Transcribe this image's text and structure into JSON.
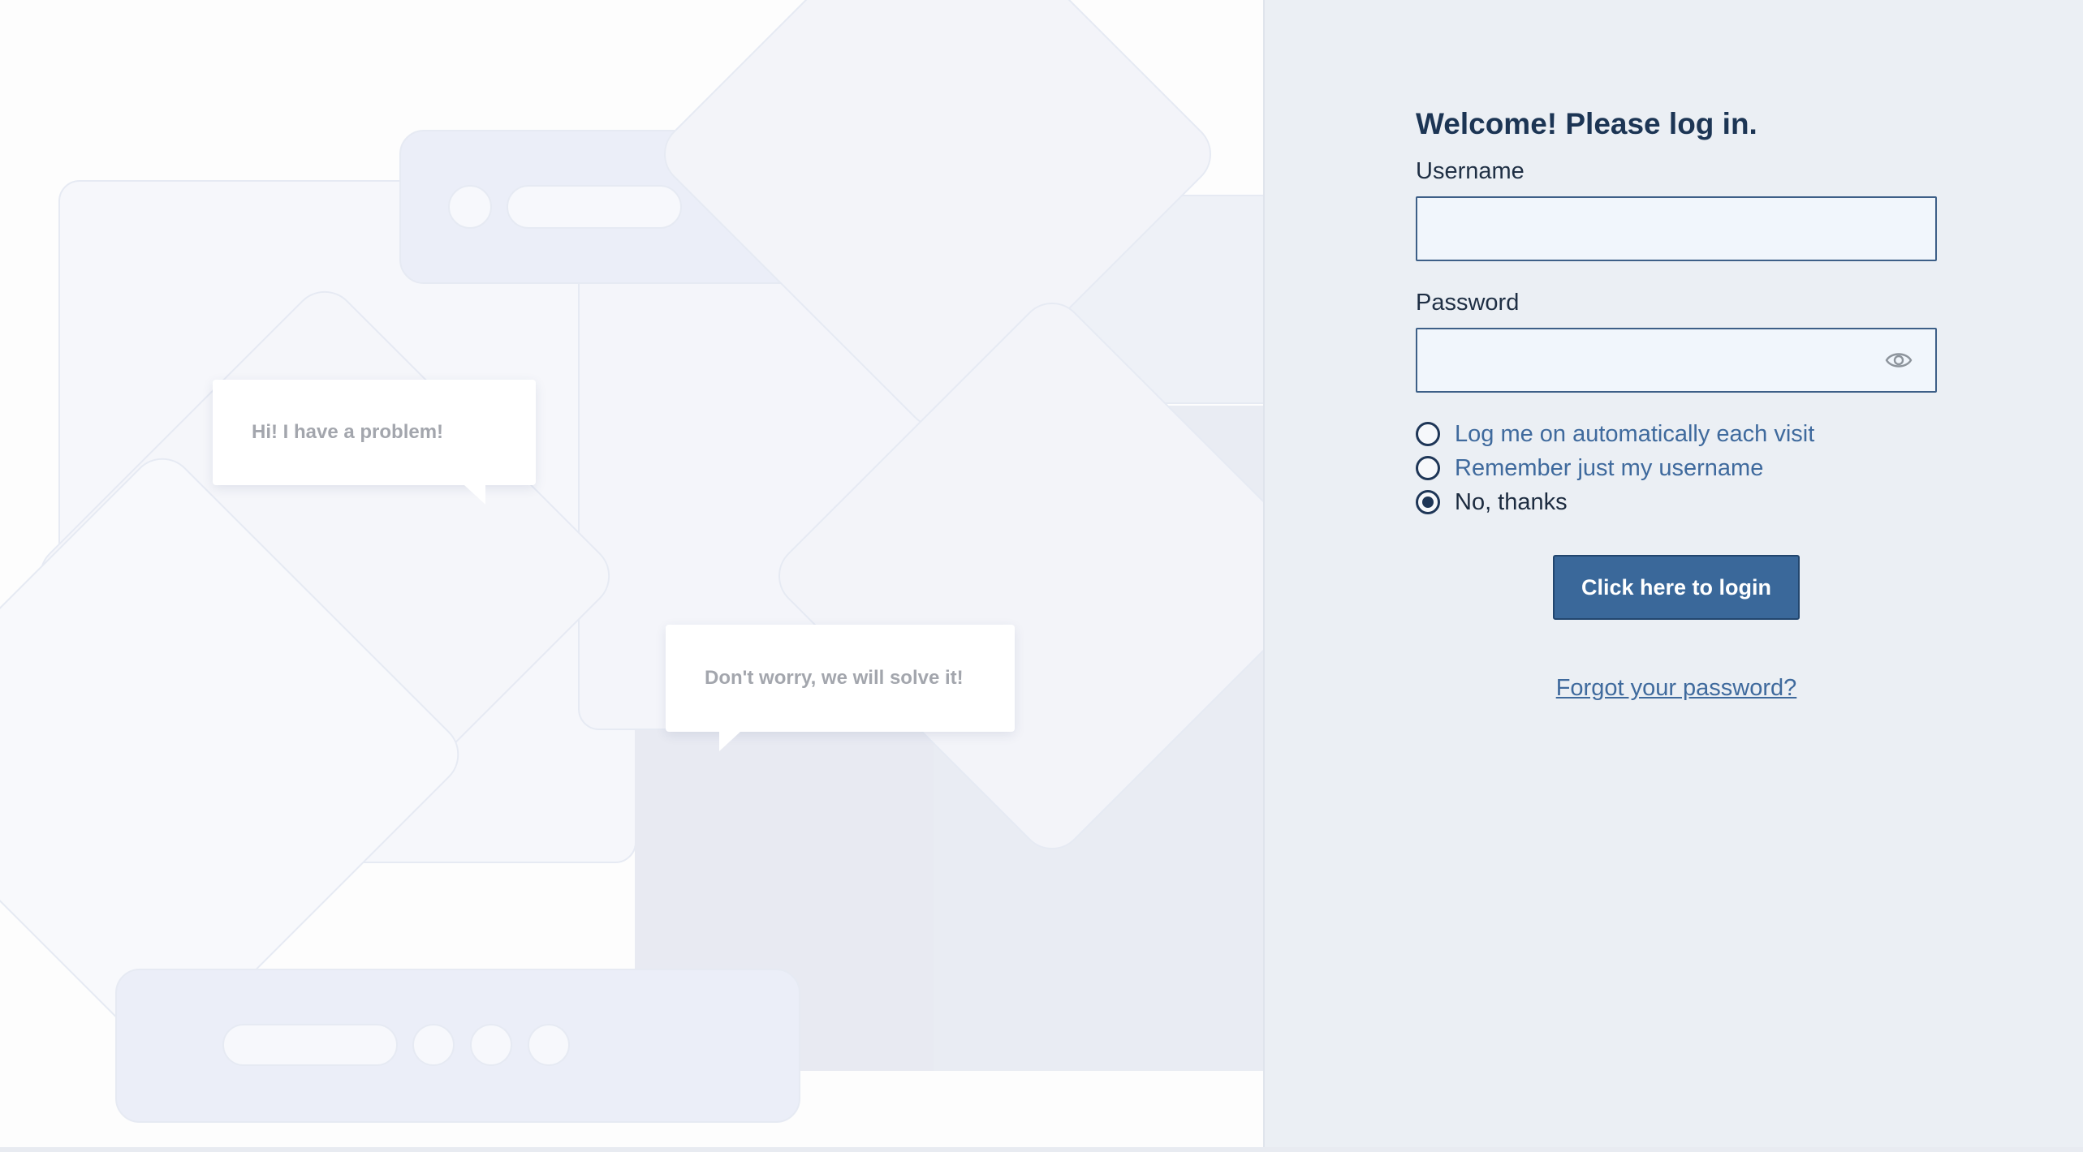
{
  "login": {
    "title": "Welcome! Please log in.",
    "username_label": "Username",
    "username_value": "",
    "password_label": "Password",
    "password_value": "",
    "show_password_icon": "eye-icon",
    "options": [
      {
        "label": "Log me on automatically each visit",
        "checked": false
      },
      {
        "label": "Remember just my username",
        "checked": false
      },
      {
        "label": "No, thanks",
        "checked": true
      }
    ],
    "login_button": "Click here to login",
    "forgot_link": "Forgot your password?"
  },
  "illustration": {
    "bubble_1": "Hi! I have a problem!",
    "bubble_2": "Don't worry, we will solve it!"
  },
  "colors": {
    "panel_bg": "#ebeff4",
    "title": "#1c3554",
    "link": "#3f6a9d",
    "button": "#3a689a",
    "input_border": "#3d5f87",
    "input_bg": "#f1f6fc"
  }
}
